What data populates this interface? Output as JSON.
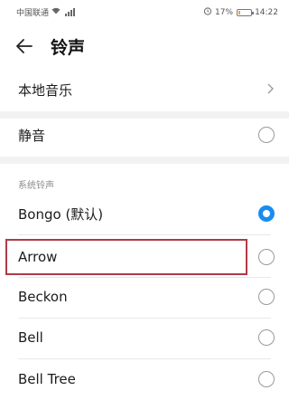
{
  "status_bar": {
    "carrier": "中国联通",
    "battery_percent": "17%",
    "battery_level": 0.17,
    "time": "14:22"
  },
  "header": {
    "title": "铃声",
    "back_icon": "arrow-left-icon"
  },
  "items": {
    "local_music": {
      "label": "本地音乐",
      "icon": "chevron-right-icon"
    },
    "silent": {
      "label": "静音",
      "checked": false
    }
  },
  "section": {
    "title": "系统铃声",
    "ringtones": [
      {
        "label": "Bongo (默认)",
        "checked": true
      },
      {
        "label": "Arrow",
        "checked": false
      },
      {
        "label": "Beckon",
        "checked": false
      },
      {
        "label": "Bell",
        "checked": false
      },
      {
        "label": "Bell Tree",
        "checked": false
      }
    ]
  },
  "colors": {
    "accent": "#1a8cf0",
    "highlight_border": "#b03a48"
  }
}
